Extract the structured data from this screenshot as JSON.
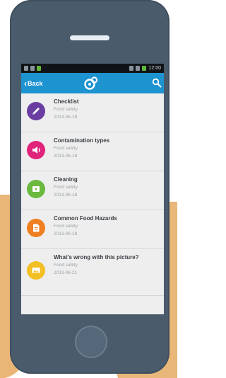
{
  "status_bar": {
    "time": "12:00"
  },
  "app_bar": {
    "back_label": "Back",
    "logo_icon": "app-logo-icon",
    "search_icon": "search-icon",
    "color": "#1d93cf"
  },
  "lessons": [
    {
      "title": "Checklist",
      "category": "Food safety",
      "date": "2013-06-18",
      "icon": "pencil-icon",
      "color": "#6a3da1"
    },
    {
      "title": "Contamination types",
      "category": "Food safety",
      "date": "2013-06-18",
      "icon": "speaker-icon",
      "color": "#e0237b"
    },
    {
      "title": "Cleaning",
      "category": "Food safety",
      "date": "2013-06-18",
      "icon": "video-icon",
      "color": "#6cb93f"
    },
    {
      "title": "Common Food Hazards",
      "category": "Food safety",
      "date": "2013-06-18",
      "icon": "document-icon",
      "color": "#f07f22"
    },
    {
      "title": "What's wrong with this picture?",
      "category": "Food safety",
      "date": "2013-06-21",
      "icon": "image-icon",
      "color": "#f2c024"
    }
  ]
}
